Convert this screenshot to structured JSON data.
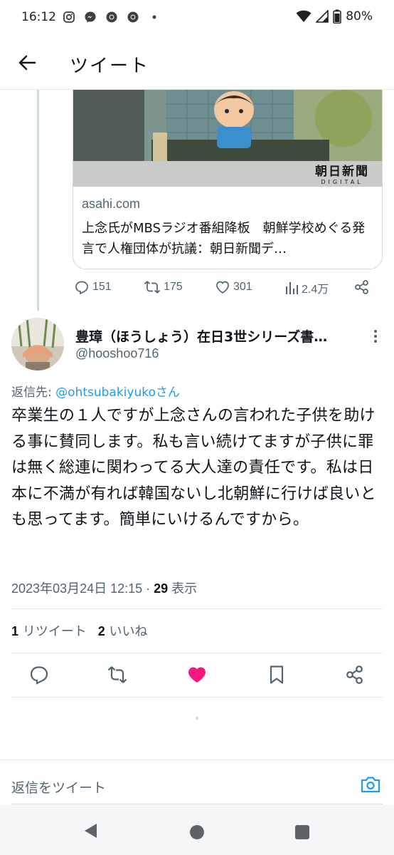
{
  "status_bar": {
    "time": "16:12",
    "battery": "80%",
    "notification_icons": [
      "instagram-icon",
      "messenger-icon",
      "chrome-icon",
      "chrome-icon",
      "dot-icon"
    ]
  },
  "app_bar": {
    "title": "ツイート"
  },
  "link_card": {
    "image_sign": "朝日新聞",
    "image_sign_sub": "DIGITAL",
    "domain": "asahi.com",
    "title": "上念氏がMBSラジオ番組降板　朝鮮学校めぐる発言で人権団体が抗議：朝日新聞デ…"
  },
  "quoted_actions": {
    "replies": "151",
    "retweets": "175",
    "likes": "301",
    "views": "2.4万"
  },
  "reply_tweet": {
    "author_name": "豊璋（ほうしょう）在日3世シリーズ書…",
    "author_handle": "@hooshoo716",
    "reply_to_label": "返信先: ",
    "reply_to_mention": "@ohtsubakiyukoさん",
    "text": "卒業生の１人ですが上念さんの言われた子供を助ける事に賛同します。私も言い続けてますが子供に罪は無く総連に関わってる大人達の責任です。私は日本に不満が有れば韓国ないし北朝鮮に行けば良いとも思ってます。簡単にいけるんですから。",
    "timestamp": "2023年03月24日 12:15 · ",
    "views_count": "29",
    "views_label": " 表示",
    "retweet_count": "1",
    "retweet_label": " リツイート",
    "like_count": "2",
    "like_label": " いいね",
    "liked": true
  },
  "composer": {
    "placeholder": "返信をツイート"
  },
  "colors": {
    "accent": "#1d9bf0",
    "like": "#f91880",
    "secondary_text": "#536471"
  }
}
